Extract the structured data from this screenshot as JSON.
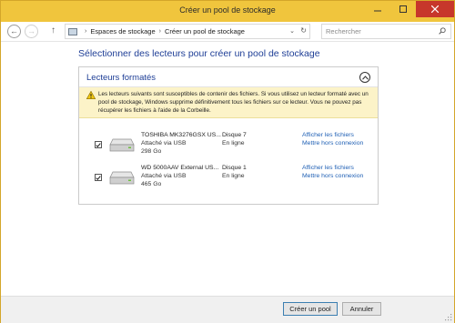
{
  "window": {
    "title": "Créer un pool de stockage"
  },
  "nav": {
    "back": "←",
    "forward": "→",
    "up": "↑",
    "breadcrumb": [
      "Espaces de stockage",
      "Créer un pool de stockage"
    ],
    "search_placeholder": "Rechercher"
  },
  "main": {
    "heading": "Sélectionner des lecteurs pour créer un pool de stockage",
    "section_title": "Lecteurs formatés",
    "warning": "Les lecteurs suivants sont susceptibles de contenir des fichiers. Si vous utilisez un lecteur formaté avec un pool de stockage, Windows supprime définitivement tous les fichiers sur ce lecteur. Vous ne pouvez pas récupérer les fichiers à l'aide de la Corbeille.",
    "drives": [
      {
        "name": "TOSHIBA MK3276GSX US...",
        "connection": "Attaché via USB",
        "size": "298 Go",
        "disk": "Disque 7",
        "status": "En ligne",
        "link_view": "Afficher les fichiers",
        "link_offline": "Mettre hors connexion",
        "checked": true
      },
      {
        "name": "WD 5000AAV External US...",
        "connection": "Attaché via USB",
        "size": "465 Go",
        "disk": "Disque 1",
        "status": "En ligne",
        "link_view": "Afficher les fichiers",
        "link_offline": "Mettre hors connexion",
        "checked": true
      }
    ]
  },
  "footer": {
    "create_button": "Créer un pool",
    "cancel_button": "Annuler"
  },
  "colors": {
    "titlebar": "#f0c53d",
    "heading": "#1e3e96",
    "link": "#1e5fb4",
    "warning_bg": "#fcf3c8"
  }
}
